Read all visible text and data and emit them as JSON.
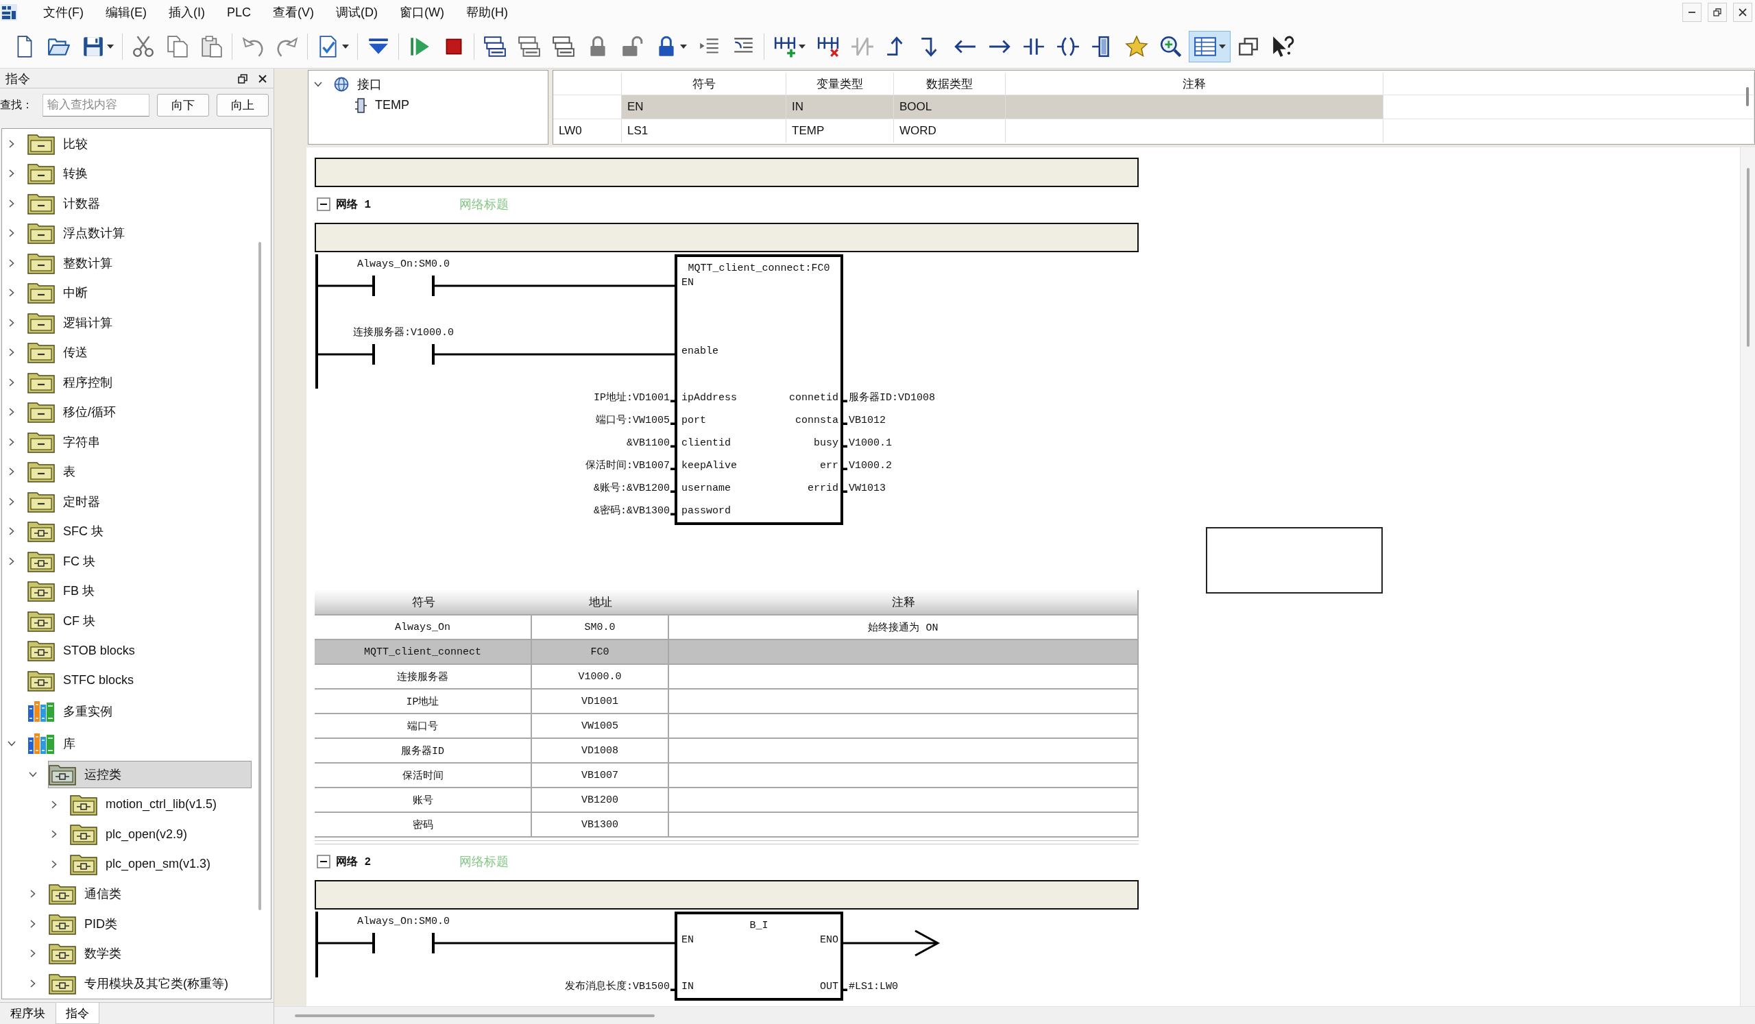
{
  "menu_bar": {
    "items": [
      "文件(F)",
      "编辑(E)",
      "插入(I)",
      "PLC",
      "查看(V)",
      "调试(D)",
      "窗口(W)",
      "帮助(H)"
    ]
  },
  "toolbar": {
    "groups": [
      [
        {
          "kind": "new",
          "pressed": false
        },
        {
          "kind": "open",
          "pressed": false
        },
        {
          "kind": "save",
          "menu": true,
          "pressed": false
        }
      ],
      [
        {
          "kind": "cut",
          "pressed": false
        },
        {
          "kind": "copy",
          "pressed": false
        },
        {
          "kind": "paste",
          "pressed": false
        }
      ],
      [
        {
          "kind": "undo",
          "pressed": false
        },
        {
          "kind": "redo",
          "pressed": false
        }
      ],
      [
        {
          "kind": "compile",
          "menu": true,
          "pressed": false
        }
      ],
      [
        {
          "kind": "download",
          "pressed": false
        }
      ],
      [
        {
          "kind": "run",
          "pressed": false
        },
        {
          "kind": "stop",
          "pressed": false
        }
      ],
      [
        {
          "kind": "stacka",
          "pressed": false
        },
        {
          "kind": "stackb",
          "pressed": false
        },
        {
          "kind": "stackc",
          "pressed": false
        },
        {
          "kind": "lock",
          "pressed": false
        },
        {
          "kind": "unlock",
          "pressed": false
        },
        {
          "kind": "protect",
          "menu": true,
          "pressed": false
        },
        {
          "kind": "indent",
          "pressed": false
        },
        {
          "kind": "outdent",
          "pressed": false
        }
      ],
      [
        {
          "kind": "netinsert",
          "menu": true,
          "pressed": false
        },
        {
          "kind": "netdelete",
          "pressed": false
        },
        {
          "kind": "negate",
          "pressed": false
        },
        {
          "kind": "branchup",
          "pressed": false
        },
        {
          "kind": "branchdown",
          "pressed": false
        },
        {
          "kind": "lineleft",
          "pressed": false
        },
        {
          "kind": "lineright",
          "pressed": false
        },
        {
          "kind": "contact",
          "pressed": false
        },
        {
          "kind": "coil",
          "pressed": false
        },
        {
          "kind": "box",
          "pressed": false
        },
        {
          "kind": "favorite",
          "pressed": false
        },
        {
          "kind": "zoom",
          "pressed": false
        },
        {
          "kind": "table",
          "menu": true,
          "pressed": true
        },
        {
          "kind": "cascade",
          "pressed": false
        },
        {
          "kind": "help",
          "pressed": false
        }
      ]
    ]
  },
  "instruction_panel": {
    "title": "指令",
    "search": {
      "label": "查找：",
      "placeholder": "输入查找内容",
      "buttons": [
        "向下",
        "向上"
      ]
    },
    "tree": [
      {
        "label": "比较",
        "kind": "category",
        "expanded": false,
        "selected": false
      },
      {
        "label": "转换",
        "kind": "category",
        "expanded": false,
        "selected": false
      },
      {
        "label": "计数器",
        "kind": "category",
        "expanded": false,
        "selected": false
      },
      {
        "label": "浮点数计算",
        "kind": "category",
        "expanded": false,
        "selected": false
      },
      {
        "label": "整数计算",
        "kind": "category",
        "expanded": false,
        "selected": false
      },
      {
        "label": "中断",
        "kind": "category",
        "expanded": false,
        "selected": false
      },
      {
        "label": "逻辑计算",
        "kind": "category",
        "expanded": false,
        "selected": false
      },
      {
        "label": "传送",
        "kind": "category",
        "expanded": false,
        "selected": false
      },
      {
        "label": "程序控制",
        "kind": "category",
        "expanded": false,
        "selected": false
      },
      {
        "label": "移位/循环",
        "kind": "category",
        "expanded": false,
        "selected": false
      },
      {
        "label": "字符串",
        "kind": "category",
        "expanded": false,
        "selected": false
      },
      {
        "label": "表",
        "kind": "category",
        "expanded": false,
        "selected": false
      },
      {
        "label": "定时器",
        "kind": "category",
        "expanded": false,
        "selected": false
      },
      {
        "label": "SFC 块",
        "kind": "block",
        "expanded": false,
        "selected": false
      },
      {
        "label": "FC 块",
        "kind": "block",
        "expanded": false,
        "selected": false
      },
      {
        "label": "FB 块",
        "kind": "block",
        "selected": false
      },
      {
        "label": "CF 块",
        "kind": "block",
        "selected": false
      },
      {
        "label": "STOB blocks",
        "kind": "block",
        "selected": false
      },
      {
        "label": "STFC blocks",
        "kind": "block",
        "selected": false
      },
      {
        "label": "多重实例",
        "kind": "library",
        "selected": false
      },
      {
        "label": "库",
        "kind": "library",
        "expanded": true,
        "selected": false,
        "children": [
          {
            "label": "运控类",
            "kind": "block",
            "expanded": true,
            "selected": true,
            "children": [
              {
                "label": "motion_ctrl_lib(v1.5)",
                "kind": "block",
                "expanded": false,
                "selected": false
              },
              {
                "label": "plc_open(v2.9)",
                "kind": "block",
                "expanded": false,
                "selected": false
              },
              {
                "label": "plc_open_sm(v1.3)",
                "kind": "block",
                "expanded": false,
                "selected": false
              }
            ]
          },
          {
            "label": "通信类",
            "kind": "block",
            "expanded": false,
            "selected": false
          },
          {
            "label": "PID类",
            "kind": "block",
            "expanded": false,
            "selected": false
          },
          {
            "label": "数学类",
            "kind": "block",
            "expanded": false,
            "selected": false
          },
          {
            "label": "专用模块及其它类(称重等)",
            "kind": "block",
            "expanded": false,
            "selected": false
          }
        ]
      }
    ],
    "tabs": [
      {
        "label": "程序块",
        "selected": false
      },
      {
        "label": "指令",
        "selected": true
      }
    ]
  },
  "interface": {
    "tree": [
      {
        "label": "接口",
        "kind": "interface",
        "expanded": true,
        "selected": false,
        "children": [
          {
            "label": "TEMP",
            "kind": "variable",
            "selected": false
          }
        ]
      }
    ],
    "table": {
      "columns": [
        "符号",
        "变量类型",
        "数据类型",
        "注释"
      ],
      "rows": [
        {
          "symbol": "EN",
          "var_type": "IN",
          "data_type": "BOOL",
          "fixed": true
        },
        {
          "address": "LW0",
          "symbol": "LS1",
          "var_type": "TEMP",
          "data_type": "WORD",
          "fixed": false
        }
      ]
    }
  },
  "editor": {
    "networks": [
      {
        "label": "网络 1",
        "title": "网络标题",
        "expanded": true,
        "block": {
          "title": "MQTT_client_connect:FC0",
          "rows": [
            {
              "input": {
                "pin": "EN",
                "kind": "contact",
                "operand": "Always_On:SM0.0"
              }
            },
            {
              "input": {
                "pin": "enable",
                "kind": "contact",
                "operand": "连接服务器:V1000.0"
              }
            },
            {
              "input": {
                "pin": "ipAddress",
                "kind": "operand",
                "operand": "IP地址:VD1001"
              },
              "output": {
                "pin": "connetid",
                "kind": "operand",
                "operand": "服务器ID:VD1008"
              }
            },
            {
              "input": {
                "pin": "port",
                "kind": "operand",
                "operand": "端口号:VW1005"
              },
              "output": {
                "pin": "connsta",
                "kind": "operand",
                "operand": "VB1012"
              }
            },
            {
              "input": {
                "pin": "clientid",
                "kind": "operand",
                "operand": "&VB1100"
              },
              "output": {
                "pin": "busy",
                "kind": "operand",
                "operand": "V1000.1"
              }
            },
            {
              "input": {
                "pin": "keepAlive",
                "kind": "operand",
                "operand": "保活时间:VB1007"
              },
              "output": {
                "pin": "err",
                "kind": "operand",
                "operand": "V1000.2"
              }
            },
            {
              "input": {
                "pin": "username",
                "kind": "operand",
                "operand": "&账号:&VB1200"
              },
              "output": {
                "pin": "errid",
                "kind": "operand",
                "operand": "VW1013"
              }
            },
            {
              "input": {
                "pin": "password",
                "kind": "operand",
                "operand": "&密码:&VB1300"
              }
            }
          ]
        },
        "symbols": {
          "columns": [
            "符号",
            "地址",
            "注释"
          ],
          "rows": [
            {
              "symbol": "Always_On",
              "address": "SM0.0",
              "comment": "始终接通为 ON",
              "selected": false
            },
            {
              "symbol": "MQTT_client_connect",
              "address": "FC0",
              "selected": true
            },
            {
              "symbol": "连接服务器",
              "address": "V1000.0",
              "selected": false
            },
            {
              "symbol": "IP地址",
              "address": "VD1001",
              "selected": false
            },
            {
              "symbol": "端口号",
              "address": "VW1005",
              "selected": false
            },
            {
              "symbol": "服务器ID",
              "address": "VD1008",
              "selected": false
            },
            {
              "symbol": "保活时间",
              "address": "VB1007",
              "selected": false
            },
            {
              "symbol": "账号",
              "address": "VB1200",
              "selected": false
            },
            {
              "symbol": "密码",
              "address": "VB1300",
              "selected": false
            }
          ]
        }
      },
      {
        "label": "网络 2",
        "title": "网络标题",
        "expanded": true,
        "block": {
          "title": "B_I",
          "rows": [
            {
              "input": {
                "pin": "EN",
                "kind": "contact",
                "operand": "Always_On:SM0.0"
              },
              "output": {
                "pin": "ENO",
                "kind": "arrow"
              }
            },
            {
              "input": {
                "pin": "IN",
                "kind": "operand",
                "operand": "发布消息长度:VB1500"
              },
              "output": {
                "pin": "OUT",
                "kind": "operand",
                "operand": "#LS1:LW0"
              }
            }
          ]
        }
      }
    ]
  }
}
